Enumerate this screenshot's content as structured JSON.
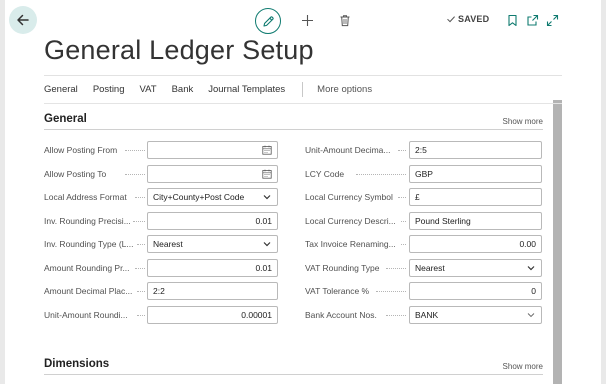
{
  "topbar": {
    "saved_label": "SAVED"
  },
  "page": {
    "title": "General Ledger Setup"
  },
  "actions": {
    "items": [
      "General",
      "Posting",
      "VAT",
      "Bank",
      "Journal Templates"
    ],
    "more": "More options"
  },
  "general": {
    "title": "General",
    "show_more": "Show more",
    "left_fields": [
      {
        "label": "Allow Posting From",
        "value": "",
        "type": "date"
      },
      {
        "label": "Allow Posting To",
        "value": "",
        "type": "date"
      },
      {
        "label": "Local Address Format",
        "value": "City+County+Post Code",
        "type": "select"
      },
      {
        "label": "Inv. Rounding Precisi...",
        "value": "0.01",
        "type": "number"
      },
      {
        "label": "Inv. Rounding Type (L...",
        "value": "Nearest",
        "type": "select"
      },
      {
        "label": "Amount Rounding Pr...",
        "value": "0.01",
        "type": "number"
      },
      {
        "label": "Amount Decimal Plac...",
        "value": "2:2",
        "type": "text"
      },
      {
        "label": "Unit-Amount Roundi...",
        "value": "0.00001",
        "type": "number"
      }
    ],
    "right_fields": [
      {
        "label": "Unit-Amount Decima...",
        "value": "2:5",
        "type": "text"
      },
      {
        "label": "LCY Code",
        "value": "GBP",
        "type": "text"
      },
      {
        "label": "Local Currency Symbol",
        "value": "£",
        "type": "text"
      },
      {
        "label": "Local Currency Descri...",
        "value": "Pound Sterling",
        "type": "text"
      },
      {
        "label": "Tax Invoice Renaming...",
        "value": "0.00",
        "type": "number"
      },
      {
        "label": "VAT Rounding Type",
        "value": "Nearest",
        "type": "select"
      },
      {
        "label": "VAT Tolerance %",
        "value": "0",
        "type": "number"
      },
      {
        "label": "Bank Account Nos.",
        "value": "BANK",
        "type": "lookup"
      }
    ]
  },
  "dimensions": {
    "title": "Dimensions",
    "show_more": "Show more"
  },
  "colors": {
    "accent": "#0f7b70",
    "border": "#b9b9b9",
    "scrollbar": "#b3b3b3"
  }
}
